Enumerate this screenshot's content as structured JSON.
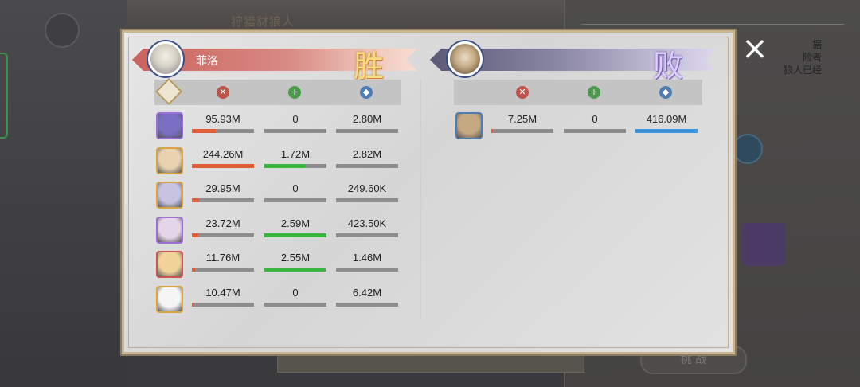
{
  "background": {
    "title": "狩猎豺狼人",
    "side_text": "据\n险者\n狼人已经",
    "button": "挑 战"
  },
  "close_icon": "×",
  "left_team": {
    "player": "菲洛",
    "result": "胜",
    "avatar_icon": "white-haired-girl-avatar",
    "rows": [
      {
        "dmg": "95.93M",
        "heal": "0",
        "def": "2.80M",
        "dmg_pct": 0.39,
        "heal_pct": 0.0,
        "def_pct": 0.0,
        "color": "#9b6fd6",
        "portrait": "#7b6fc4"
      },
      {
        "dmg": "244.26M",
        "heal": "1.72M",
        "def": "2.82M",
        "dmg_pct": 1.0,
        "heal_pct": 0.66,
        "def_pct": 0.0,
        "color": "#d9a441",
        "portrait": "#e8d2b0"
      },
      {
        "dmg": "29.95M",
        "heal": "0",
        "def": "249.60K",
        "dmg_pct": 0.12,
        "heal_pct": 0.0,
        "def_pct": 0.0,
        "color": "#d9a441",
        "portrait": "#c7c3e0"
      },
      {
        "dmg": "23.72M",
        "heal": "2.59M",
        "def": "423.50K",
        "dmg_pct": 0.1,
        "heal_pct": 1.0,
        "def_pct": 0.0,
        "color": "#9b6fd6",
        "portrait": "#e5d5e8"
      },
      {
        "dmg": "11.76M",
        "heal": "2.55M",
        "def": "1.46M",
        "dmg_pct": 0.05,
        "heal_pct": 0.98,
        "def_pct": 0.0,
        "color": "#c9564f",
        "portrait": "#f0d49a"
      },
      {
        "dmg": "10.47M",
        "heal": "0",
        "def": "6.42M",
        "dmg_pct": 0.04,
        "heal_pct": 0.0,
        "def_pct": 0.0,
        "color": "#d9a441",
        "portrait": "#f5f5f5"
      }
    ]
  },
  "right_team": {
    "result": "败",
    "avatar_icon": "gnoll-boss-avatar",
    "rows": [
      {
        "dmg": "7.25M",
        "heal": "0",
        "def": "416.09M",
        "dmg_pct": 0.03,
        "heal_pct": 0.0,
        "def_pct": 1.0,
        "color": "#4f7cb0",
        "portrait": "#c4a982"
      }
    ]
  },
  "header_icons": {
    "attack": "crossed-swords-icon",
    "heal": "plus-cross-icon",
    "defense": "shield-icon"
  }
}
